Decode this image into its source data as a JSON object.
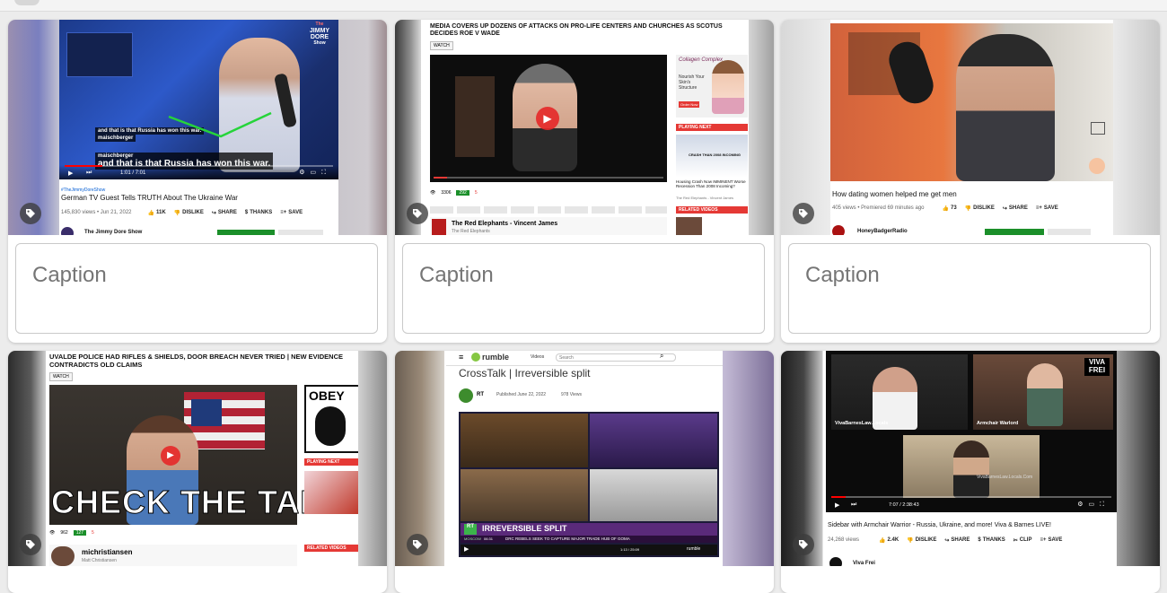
{
  "caption_placeholder": "Caption",
  "cards": [
    {
      "channel_tag": "#TheJimmyDoreShow",
      "video_title": "German TV Guest Tells TRUTH About The Ukraine War",
      "views": "145,830 views • Jun 21, 2022",
      "likes": "11K",
      "dislike": "DISLIKE",
      "share": "SHARE",
      "thanks": "THANKS",
      "save": "SAVE",
      "channel": "The Jimmy Dore Show",
      "time": "1:01 / 7:01",
      "caption_line1": "maischberger",
      "caption_line2": "and that is that Russia has won this war.",
      "logo_line1": "The",
      "logo_line2": "JIMMY",
      "logo_line3": "DORE",
      "logo_line4": "Show"
    },
    {
      "headline": "MEDIA COVERS UP DOZENS OF ATTACKS ON PRO-LIFE CENTERS AND CHURCHES AS SCOTUS DECIDES ROE V WADE",
      "watch": "WATCH",
      "views": "3306",
      "likes": "292",
      "dislikes": "5",
      "channel": "The Red Elephants - Vincent James",
      "channel_sub": "The Red Elephants",
      "ad_title": "Collagen Complex",
      "ad_text": "Nourish Your Skin's Structure",
      "ad_button": "Order Now",
      "playing_next": "PLAYING NEXT",
      "next_text": "Housing Crash Now IMMINENT Worse Recession Than 2008 Incoming?",
      "next_channel": "The Red Elephants - Vincent James",
      "next_tagline": "CRASH THAN 2008 INCOMING",
      "related": "RELATED VIDEOS"
    },
    {
      "video_title": "How dating women helped me get men",
      "views": "405 views • Premiered 69 minutes ago",
      "likes": "73",
      "dislike": "DISLIKE",
      "share": "SHARE",
      "save": "SAVE",
      "channel": "HoneyBadgerRadio"
    },
    {
      "headline": "UVALDE POLICE HAD RIFLES & SHIELDS, DOOR BREACH NEVER TRIED | NEW EVIDENCE CONTRADICTS OLD CLAIMS",
      "watch": "WATCH",
      "overlay": "CHECK THE TAPE",
      "views": "962",
      "likes": "127",
      "dislikes": "5",
      "channel": "michristiansen",
      "channel_sub": "Matt Christiansen",
      "playing_next": "PLAYING NEXT",
      "related": "RELATED VIDEOS",
      "obey": "OBEY"
    },
    {
      "brand": "rumble",
      "nav_videos": "Videos",
      "search_placeholder": "Search",
      "video_title": "CrossTalk | Irreversible split",
      "channel": "RT",
      "published": "Published June 22, 2022",
      "views": "978 Views",
      "banner": "IRREVERSIBLE SPLIT",
      "banner_sub": "DRC REBELS SEEK TO CAPTURE MAJOR TRADE HUB OF GOMA",
      "location": "MOSCOW",
      "clock": "06:31",
      "time": "1:13 / 25:09",
      "brand_small": "rumble"
    },
    {
      "brand_line1": "VIVA",
      "brand_line2": "FREI",
      "label_left": "VivaBarnesLaw.Locals",
      "label_right": "Armchair Warlord",
      "url_overlay": "VivaBarnesLaw.Locals.Com",
      "time": "7:07 / 2:38:43",
      "video_title": "Sidebar with Armchair Warrior - Russia, Ukraine, and more! Viva & Barnes LIVE!",
      "views": "24,268 views",
      "likes": "2.4K",
      "dislike": "DISLIKE",
      "share": "SHARE",
      "thanks": "THANKS",
      "clip": "CLIP",
      "save": "SAVE",
      "channel": "Viva Frei"
    }
  ],
  "colors": {
    "accent_red": "#e53935",
    "subscribe_green": "#1b8f2a",
    "caption_text": "#757575"
  }
}
